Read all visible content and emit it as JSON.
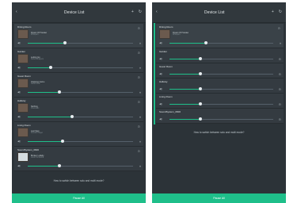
{
  "colors": {
    "accent": "#1fbf8a",
    "panel": "#2c3338"
  },
  "left": {
    "header": {
      "title": "Device List",
      "plus_icon": "+",
      "refresh_icon": "↻",
      "back_icon": "‹"
    },
    "rooms": [
      {
        "name": "Dining Room",
        "song": "Dream Of Hanalei",
        "artist": "Whispers",
        "volume": 0.35
      },
      {
        "name": "Garden",
        "song": "Letting Go",
        "artist": "Sinful Whispers",
        "volume": 0.22
      },
      {
        "name": "Guest Room",
        "song": "Clapping Game",
        "artist": "Sweet Kids",
        "volume": 0.3
      },
      {
        "name": "Hallway",
        "song": "Nothing",
        "artist": "Onemusic",
        "volume": 0.42
      },
      {
        "name": "Living Room",
        "song": "Last Step",
        "artist": "Smooth Player",
        "volume": 0.33
      },
      {
        "name": "SoundSystem_0600",
        "song": "Broken Lullaby",
        "artist": "Louis Orchestra",
        "volume": 0.3
      }
    ],
    "hint": "How to switch between solo and multi mode?",
    "pause_label": "Pause All"
  },
  "right": {
    "header": {
      "title": "Device List",
      "plus_icon": "+",
      "refresh_icon": "↻",
      "back_icon": "‹"
    },
    "group_room": {
      "name": "Dining Room",
      "song": "Dream Of Hanalei",
      "artist": "Whispers",
      "volume": 0.35
    },
    "members": [
      {
        "name": "Garden",
        "volume": 0.3
      },
      {
        "name": "Guest Room",
        "volume": 0.3
      },
      {
        "name": "Hallway",
        "volume": 0.3
      },
      {
        "name": "Living Room",
        "volume": 0.3
      },
      {
        "name": "SoundSystem_0600",
        "volume": 0.3
      }
    ],
    "hint": "How to switch between solo and multi mode?",
    "pause_label": "Pause All"
  }
}
